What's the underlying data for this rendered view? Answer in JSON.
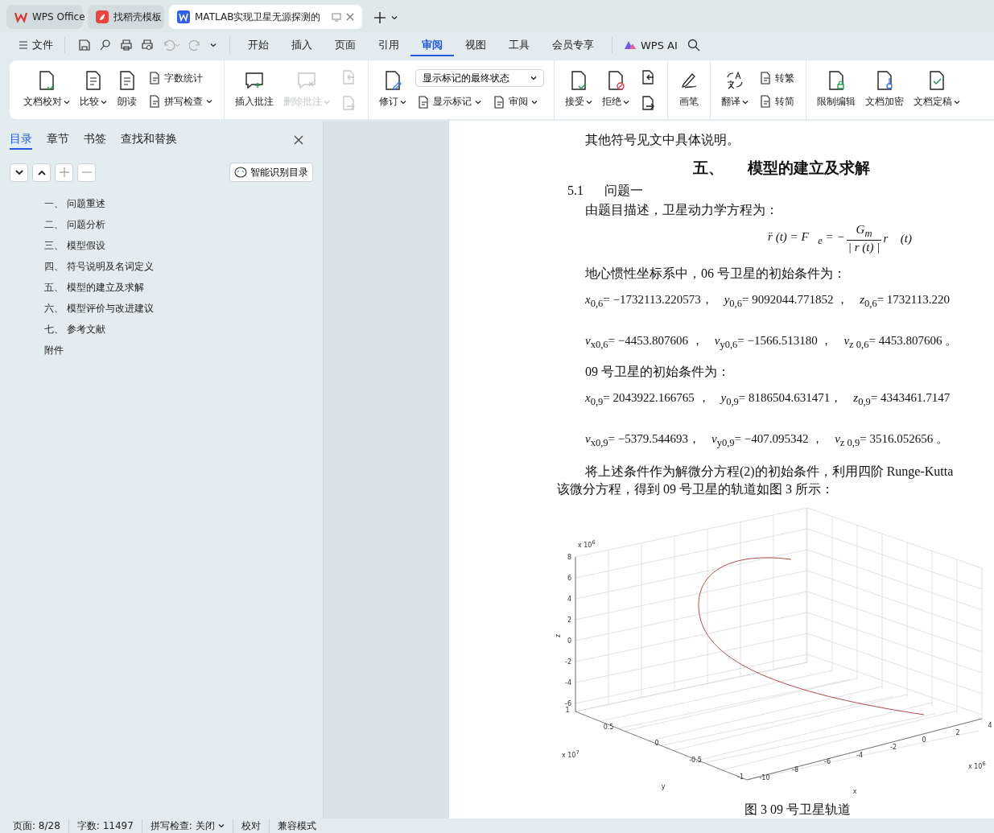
{
  "app_tabs": [
    {
      "label": "WPS Office",
      "selected": false
    },
    {
      "label": "找稻壳模板",
      "selected": false
    },
    {
      "label": "MATLAB实现卫星无源探测的",
      "selected": true
    }
  ],
  "menu": {
    "file": "文件",
    "tabs": [
      {
        "label": "开始",
        "selected": false
      },
      {
        "label": "插入",
        "selected": false
      },
      {
        "label": "页面",
        "selected": false
      },
      {
        "label": "引用",
        "selected": false
      },
      {
        "label": "审阅",
        "selected": true
      },
      {
        "label": "视图",
        "selected": false
      },
      {
        "label": "工具",
        "selected": false
      },
      {
        "label": "会员专享",
        "selected": false
      }
    ],
    "ai": "WPS AI"
  },
  "ribbon": [
    {
      "items": [
        {
          "kind": "large",
          "label": "文档校对",
          "menu": true,
          "disabled": false
        },
        {
          "kind": "large",
          "label": "比较",
          "menu": true,
          "disabled": false
        },
        {
          "kind": "large",
          "label": "朗读",
          "menu": false,
          "disabled": false
        },
        {
          "kind": "small",
          "label": "字数统计",
          "menu": false,
          "disabled": false
        },
        {
          "kind": "small",
          "label": "拼写检查",
          "menu": true,
          "disabled": false
        }
      ]
    },
    {
      "items": [
        {
          "kind": "large",
          "label": "插入批注",
          "menu": false,
          "disabled": false
        },
        {
          "kind": "large",
          "label": "删除批注",
          "menu": true,
          "disabled": true
        },
        {
          "kind": "icon",
          "disabled": true
        },
        {
          "kind": "icon",
          "disabled": true
        }
      ]
    },
    {
      "items": [
        {
          "kind": "large",
          "label": "修订",
          "menu": true,
          "disabled": false
        },
        {
          "kind": "dropdown",
          "label": "显示标记的最终状态"
        },
        {
          "kind": "small",
          "label": "显示标记",
          "menu": true,
          "disabled": false
        },
        {
          "kind": "small",
          "label": "审阅",
          "menu": true,
          "disabled": false
        }
      ]
    },
    {
      "items": [
        {
          "kind": "large",
          "label": "接受",
          "menu": true,
          "disabled": false
        },
        {
          "kind": "large",
          "label": "拒绝",
          "menu": true,
          "disabled": false
        },
        {
          "kind": "icon",
          "disabled": false
        },
        {
          "kind": "icon",
          "disabled": false
        }
      ]
    },
    {
      "items": [
        {
          "kind": "large",
          "label": "画笔",
          "menu": false,
          "disabled": false
        }
      ]
    },
    {
      "items": [
        {
          "kind": "large",
          "label": "翻译",
          "menu": true,
          "disabled": false
        },
        {
          "kind": "small",
          "label": "转繁",
          "menu": false,
          "disabled": false
        },
        {
          "kind": "small",
          "label": "转简",
          "menu": false,
          "disabled": false
        }
      ]
    },
    {
      "items": [
        {
          "kind": "large",
          "label": "限制编辑",
          "menu": false,
          "disabled": false
        },
        {
          "kind": "large",
          "label": "文档加密",
          "menu": false,
          "disabled": false
        },
        {
          "kind": "large",
          "label": "文档定稿",
          "menu": true,
          "disabled": false
        }
      ]
    }
  ],
  "sidebar": {
    "tabs": [
      {
        "label": "目录",
        "selected": true
      },
      {
        "label": "章节",
        "selected": false
      },
      {
        "label": "书签",
        "selected": false
      },
      {
        "label": "查找和替换",
        "selected": false
      }
    ],
    "smart_button": "智能识别目录",
    "toc": [
      {
        "number": "一、",
        "title": "问题重述"
      },
      {
        "number": "二、",
        "title": "问题分析"
      },
      {
        "number": "三、",
        "title": "模型假设"
      },
      {
        "number": "四、",
        "title": "符号说明及名词定义"
      },
      {
        "number": "五、",
        "title": "模型的建立及求解"
      },
      {
        "number": "六、",
        "title": "模型评价与改进建议"
      },
      {
        "number": "七、",
        "title": "参考文献"
      },
      {
        "title": "附件"
      }
    ]
  },
  "document": {
    "intro": "其他符号见文中具体说明。",
    "heading": {
      "number": "五、",
      "title": "模型的建立及求解"
    },
    "subheading": {
      "number": "5.1",
      "title": "问题一"
    },
    "equation_intro": "由题目描述，卫星动力学方程为：",
    "formula": {
      "lhs": "r̈ (t) = F⃗$_{e}$ = −",
      "numerator": "G$_{m}$",
      "denominator": "| r (t) |",
      "rhs": "r⃗ (t)"
    },
    "sat06_intro": "地心惯性坐标系中，06 号卫星的初始条件为：",
    "sat06_position": [
      "*x*$_{0,6}$= −1732113.220573，",
      "*y*$_{0,6}$= 9092044.771852 ，",
      "*z*$_{0,6}$= 1732113.220"
    ],
    "sat06_velocity": [
      "*v*$_{x0,6}$= −4453.807606 ，",
      "*v*$_{y0,6}$= −1566.513180 ，",
      "*v*$_{z 0,6}$= 4453.807606 。"
    ],
    "sat09_intro": "09 号卫星的初始条件为：",
    "sat09_position": [
      "*x*$_{0,9}$= 2043922.166765 ，",
      "*y*$_{0,9}$= 8186504.631471，",
      "*z*$_{0,9}$= 4343461.7147"
    ],
    "sat09_velocity": [
      "*v*$_{x0,9}$= −5379.544693，",
      "*v*$_{y0,9}$= −407.095342 ，",
      "*v*$_{z 0,9}$= 3516.052656 。"
    ],
    "method_line1": "将上述条件作为解微分方程(2)的初始条件，利用四阶  Runge-Kutta",
    "method_line2": "该微分方程，得到  09 号卫星的轨道如图  3 所示：",
    "figure": {
      "z_scale": "x 10$^{6}$",
      "z_label": "z",
      "z_ticks": [
        "8",
        "6",
        "4",
        "2",
        "0",
        "-2",
        "-4",
        "-6"
      ],
      "y_scale": "x 10$^{7}$",
      "y_label": "y",
      "y_ticks": [
        "1",
        "0.5",
        "0",
        "-0.5",
        "-1"
      ],
      "x_scale": "x 10$^{6}$",
      "x_label": "x",
      "x_ticks": [
        "-10",
        "-8",
        "-6",
        "-4",
        "-2",
        "0",
        "2",
        "4"
      ]
    },
    "caption": "图 3      09 号卫星轨道"
  },
  "status_bar": [
    {
      "kind": "text",
      "label": "页面: 8/28"
    },
    {
      "kind": "text",
      "label": "字数: 11497"
    },
    {
      "kind": "menu",
      "label": "拼写检查: 关闭"
    },
    {
      "kind": "text",
      "label": "校对"
    },
    {
      "kind": "text",
      "label": "兼容模式"
    }
  ]
}
